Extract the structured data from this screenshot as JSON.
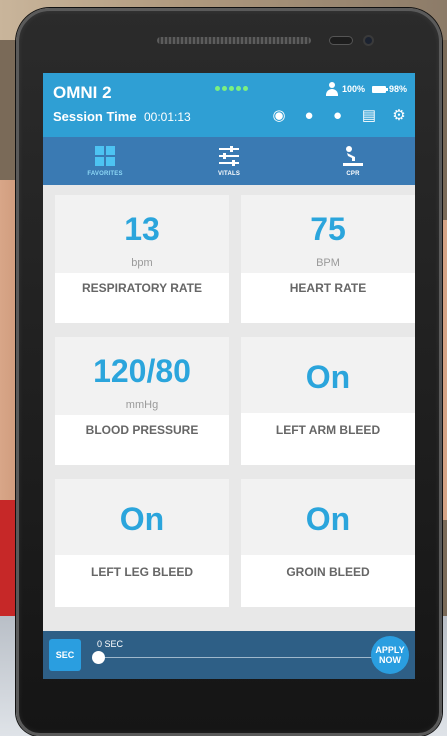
{
  "app": {
    "title": "OMNI 2",
    "session_label": "Session Time",
    "session_time": "00:01:13",
    "user_battery": "100%",
    "device_battery": "98%",
    "icons": [
      "voice-icon",
      "palette-icon",
      "group-icon",
      "chat-icon",
      "gear-icon"
    ]
  },
  "tabs": [
    {
      "label": "FAVORITES",
      "icon": "grid-icon",
      "active": true
    },
    {
      "label": "VITALS",
      "icon": "sliders-icon",
      "active": false
    },
    {
      "label": "CPR",
      "icon": "cpr-icon",
      "active": false
    }
  ],
  "cards": [
    {
      "value": "13",
      "unit": "bpm",
      "label": "RESPIRATORY RATE"
    },
    {
      "value": "75",
      "unit": "BPM",
      "label": "HEART RATE"
    },
    {
      "value": "120/80",
      "unit": "mmHg",
      "label": "BLOOD PRESSURE"
    },
    {
      "value": "On",
      "unit": "",
      "label": "LEFT ARM BLEED"
    },
    {
      "value": "On",
      "unit": "",
      "label": "LEFT LEG BLEED"
    },
    {
      "value": "On",
      "unit": "",
      "label": "GROIN BLEED"
    }
  ],
  "bottom": {
    "sec_button": "SEC",
    "sec_value": "0 SEC",
    "slider_value": 0,
    "apply_label": "APPLY NOW"
  },
  "colors": {
    "appbar": "#2f9fd4",
    "tabbar": "#3a7ab3",
    "accent": "#2ba5dc",
    "bottombar": "#2e5f86"
  }
}
